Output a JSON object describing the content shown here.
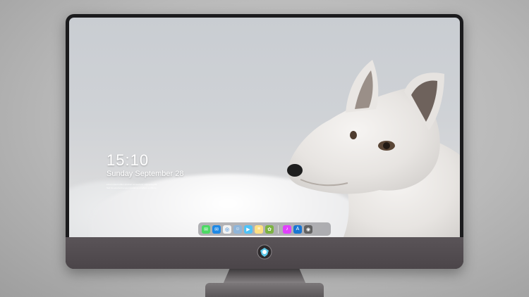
{
  "lock_screen": {
    "time": "15:10",
    "date": "Sunday September 28",
    "info_line_1": "Lorem ipsum dolor sit amet consectetur adipiscing elit",
    "info_line_2": "Sed do eiusmod tempor incididunt ut labore et dolore"
  },
  "dock": {
    "items": [
      {
        "icon": "messages-icon",
        "color": "#4cd964"
      },
      {
        "icon": "mail-icon",
        "color": "#1e88e5"
      },
      {
        "icon": "safari-icon",
        "color": "#f2f2f2"
      },
      {
        "icon": "finder-icon",
        "color": "#8fb5d9"
      },
      {
        "icon": "video-icon",
        "color": "#4fc3f7"
      },
      {
        "icon": "notes-icon",
        "color": "#ffe082"
      },
      {
        "icon": "photos-icon",
        "color": "#7cb342"
      },
      {
        "icon": "music-icon",
        "color": "#e040fb"
      },
      {
        "icon": "app-store-icon",
        "color": "#1976d2"
      },
      {
        "icon": "camera-icon",
        "color": "#616161"
      }
    ]
  },
  "colors": {
    "bezel": "#1b1b1d",
    "chin": "#524c50",
    "accent_logo": "#5bc8e8"
  }
}
